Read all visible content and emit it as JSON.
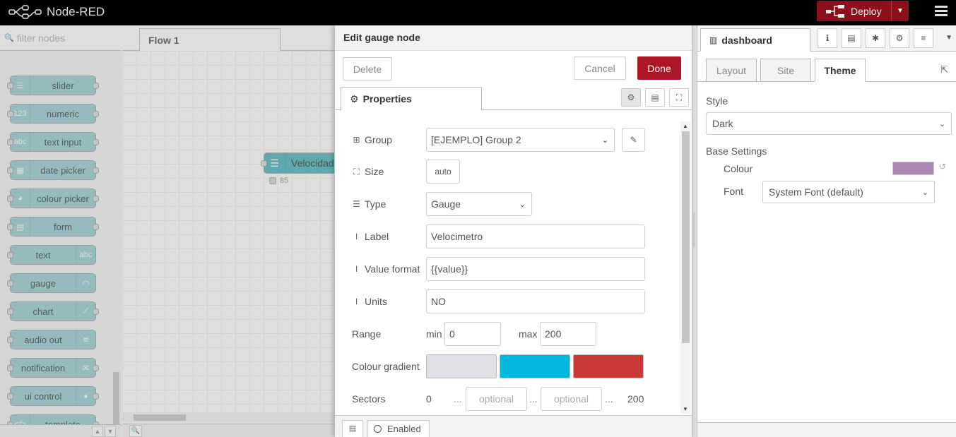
{
  "app": {
    "title": "Node-RED"
  },
  "header": {
    "deploy_label": "Deploy"
  },
  "palette": {
    "search_placeholder": "filter nodes",
    "nodes": [
      {
        "label": "slider",
        "icon": "slider-icon",
        "glyph": "☰"
      },
      {
        "label": "numeric",
        "icon": "numeric-icon",
        "glyph": "123"
      },
      {
        "label": "text input",
        "icon": "text-input-icon",
        "glyph": "abc"
      },
      {
        "label": "date picker",
        "icon": "calendar-icon",
        "glyph": "▦"
      },
      {
        "label": "colour picker",
        "icon": "palette-icon",
        "glyph": "◕"
      },
      {
        "label": "form",
        "icon": "form-icon",
        "glyph": "▤"
      },
      {
        "label": "text",
        "icon": "text-icon",
        "glyph": "abc"
      },
      {
        "label": "gauge",
        "icon": "gauge-icon",
        "glyph": "◠"
      },
      {
        "label": "chart",
        "icon": "chart-icon",
        "glyph": "📈"
      },
      {
        "label": "audio out",
        "icon": "audio-icon",
        "glyph": "≋"
      },
      {
        "label": "notification",
        "icon": "envelope-icon",
        "glyph": "✉"
      },
      {
        "label": "ui control",
        "icon": "control-icon",
        "glyph": "➧"
      },
      {
        "label": "template",
        "icon": "code-icon",
        "glyph": "</>"
      }
    ]
  },
  "workspace": {
    "tab_label": "Flow 1",
    "node_label": "Velocidad",
    "node_status": "85"
  },
  "tray": {
    "title": "Edit gauge node",
    "delete_label": "Delete",
    "cancel_label": "Cancel",
    "done_label": "Done",
    "tab_properties": "Properties",
    "group_label": "Group",
    "group_value": "[EJEMPLO] Group 2",
    "size_label": "Size",
    "size_value": "auto",
    "type_label": "Type",
    "type_value": "Gauge",
    "label_label": "Label",
    "label_value": "Velocimetro",
    "format_label": "Value format",
    "format_value": "{{value}}",
    "units_label": "Units",
    "units_value": "NO",
    "range_label": "Range",
    "min_label": "min",
    "min_value": "0",
    "max_label": "max",
    "max_value": "200",
    "gradient_label": "Colour gradient",
    "gradient_colors": [
      "#e0e0e6",
      "#00b7de",
      "#ca3838"
    ],
    "sectors_label": "Sectors",
    "sector_start": "0",
    "sector_dots": "...",
    "sector_placeholder": "optional",
    "sector_end": "200",
    "enabled_label": "Enabled"
  },
  "sidebar": {
    "tab_label": "dashboard",
    "sub_tabs": [
      "Layout",
      "Site",
      "Theme"
    ],
    "style_label": "Style",
    "style_value": "Dark",
    "base_settings_label": "Base Settings",
    "colour_label": "Colour",
    "colour_value": "#ab87b4",
    "font_label": "Font",
    "font_value": "System Font (default)"
  },
  "colors": {
    "header_bg": "#000000",
    "deploy_bg": "#8c101c",
    "done_bg": "#ad1625",
    "ui_node_bg": "#3fadb5"
  }
}
